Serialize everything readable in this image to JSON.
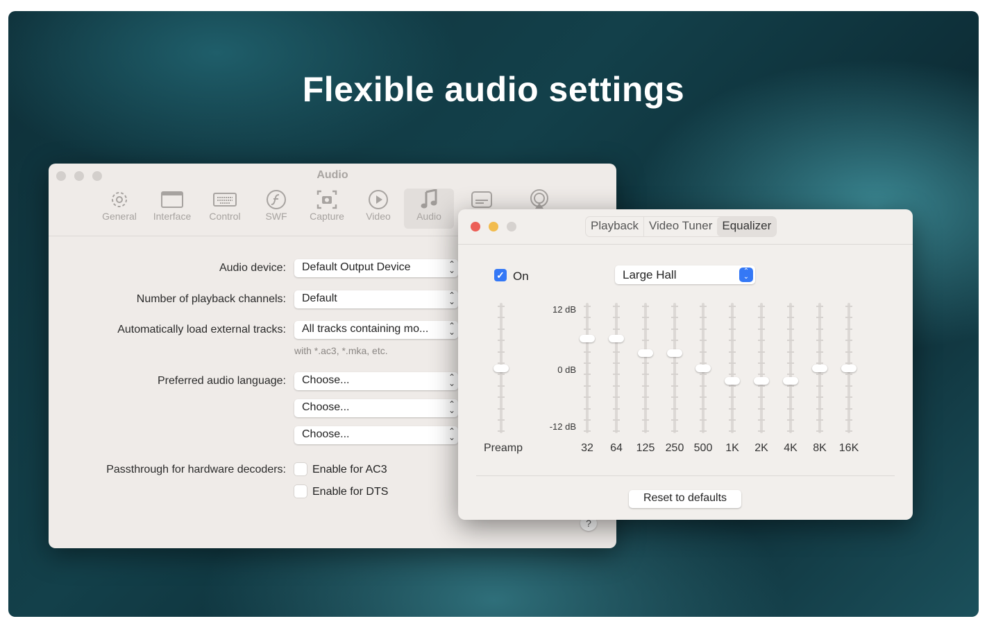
{
  "headline": "Flexible audio settings",
  "prefs_window": {
    "title": "Audio",
    "toolbar": [
      {
        "label": "General",
        "icon": "gear-icon"
      },
      {
        "label": "Interface",
        "icon": "window-icon"
      },
      {
        "label": "Control",
        "icon": "keyboard-icon"
      },
      {
        "label": "SWF",
        "icon": "flash-icon"
      },
      {
        "label": "Capture",
        "icon": "camera-icon"
      },
      {
        "label": "Video",
        "icon": "play-icon"
      },
      {
        "label": "Audio",
        "icon": "music-note-icon",
        "selected": true
      },
      {
        "label": "",
        "icon": "subtitles-icon"
      },
      {
        "label": "",
        "icon": "airplay-icon"
      }
    ],
    "audio_device": {
      "label": "Audio device:",
      "value": "Default Output Device"
    },
    "channels": {
      "label": "Number of playback channels:",
      "value": "Default"
    },
    "external": {
      "label": "Automatically load external tracks:",
      "value": "All tracks containing mo...",
      "hint": "with *.ac3, *.mka, etc."
    },
    "language": {
      "label": "Preferred audio language:",
      "values": [
        "Choose...",
        "Choose...",
        "Choose..."
      ]
    },
    "passthrough": {
      "label": "Passthrough for hardware decoders:",
      "options": [
        {
          "label": "Enable for AC3",
          "checked": false
        },
        {
          "label": "Enable for DTS",
          "checked": false
        }
      ]
    },
    "help": "?"
  },
  "eq_window": {
    "tabs": [
      "Playback",
      "Video Tuner",
      "Equalizer"
    ],
    "active_tab": "Equalizer",
    "on_label": "On",
    "on_checked": true,
    "preset": "Large Hall",
    "db_labels": [
      "12 dB",
      "0 dB",
      "-12 dB"
    ],
    "preamp": {
      "label": "Preamp",
      "value": 0
    },
    "bands": [
      {
        "label": "32",
        "value": 6
      },
      {
        "label": "64",
        "value": 6
      },
      {
        "label": "125",
        "value": 3
      },
      {
        "label": "250",
        "value": 3
      },
      {
        "label": "500",
        "value": 0
      },
      {
        "label": "1K",
        "value": -2.5
      },
      {
        "label": "2K",
        "value": -2.5
      },
      {
        "label": "4K",
        "value": -2.5
      },
      {
        "label": "8K",
        "value": 0
      },
      {
        "label": "16K",
        "value": 0
      }
    ],
    "range_db": [
      -12,
      12
    ],
    "reset_label": "Reset to defaults",
    "accent": "#3478f6"
  }
}
